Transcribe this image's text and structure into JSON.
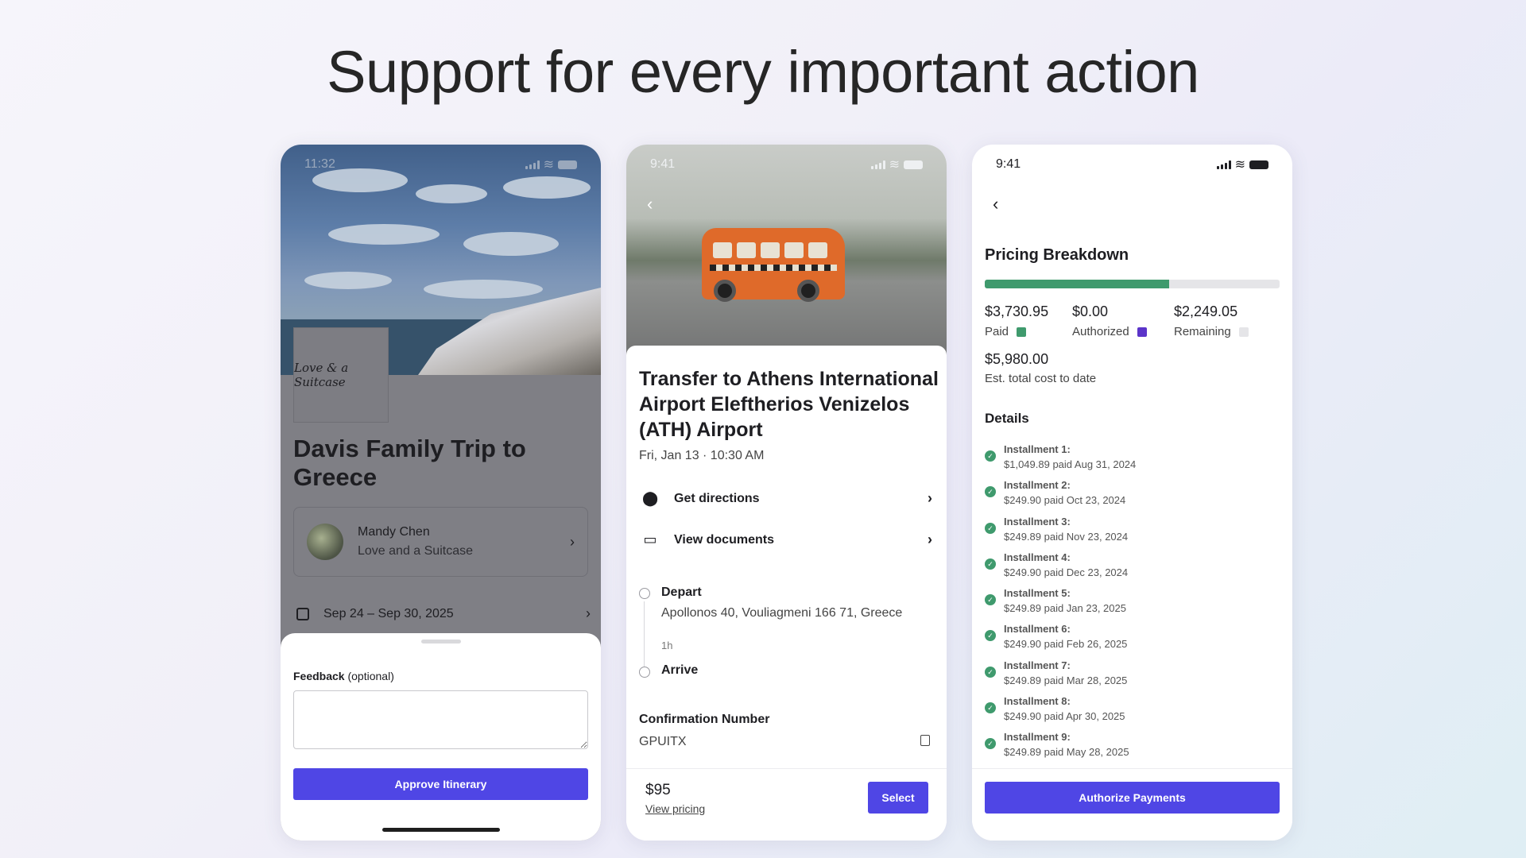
{
  "headline": "Support for every important action",
  "phone1": {
    "status_time": "11:32",
    "logo_text": "Love & a Suitcase",
    "trip_title": "Davis Family Trip to Greece",
    "agent_name": "Mandy Chen",
    "agent_org": "Love and a Suitcase",
    "date_range": "Sep 24 – Sep 30, 2025",
    "feedback_label": "Feedback",
    "feedback_optional": "(optional)",
    "feedback_value": "",
    "approve_label": "Approve Itinerary"
  },
  "phone2": {
    "status_time": "9:41",
    "title": "Transfer to Athens International Airport Eleftherios Venizelos (ATH) Airport",
    "date": "Fri, Jan 13 · 10:30 AM",
    "actions": [
      {
        "label": "Get directions",
        "icon": "location-pin-icon"
      },
      {
        "label": "View documents",
        "icon": "document-icon"
      }
    ],
    "depart_label": "Depart",
    "depart_address": "Apollonos 40, Vouliagmeni 166 71, Greece",
    "duration": "1h",
    "arrive_label": "Arrive",
    "confirmation_label": "Confirmation Number",
    "confirmation_value": "GPUITX",
    "price": "$95",
    "view_pricing": "View pricing",
    "select_label": "Select"
  },
  "phone3": {
    "status_time": "9:41",
    "title": "Pricing Breakdown",
    "progress_paid_fraction": 0.624,
    "paid_amount": "$3,730.95",
    "paid_label": "Paid",
    "authorized_amount": "$0.00",
    "authorized_label": "Authorized",
    "remaining_amount": "$2,249.05",
    "remaining_label": "Remaining",
    "total_amount": "$5,980.00",
    "total_label": "Est. total cost to date",
    "details_title": "Details",
    "installments": [
      {
        "name": "Installment 1:",
        "detail": "$1,049.89 paid Aug 31, 2024"
      },
      {
        "name": "Installment 2:",
        "detail": "$249.90 paid Oct 23, 2024"
      },
      {
        "name": "Installment 3:",
        "detail": "$249.89 paid Nov 23, 2024"
      },
      {
        "name": "Installment 4:",
        "detail": "$249.90 paid Dec 23, 2024"
      },
      {
        "name": "Installment 5:",
        "detail": "$249.89 paid Jan 23, 2025"
      },
      {
        "name": "Installment 6:",
        "detail": "$249.90 paid Feb 26, 2025"
      },
      {
        "name": "Installment 7:",
        "detail": "$249.89 paid Mar 28, 2025"
      },
      {
        "name": "Installment 8:",
        "detail": "$249.90 paid Apr 30, 2025"
      },
      {
        "name": "Installment 9:",
        "detail": "$249.89 paid May 28, 2025"
      }
    ],
    "authorize_label": "Authorize Payments"
  },
  "colors": {
    "accent": "#4f46e5",
    "paid": "#3f9a6d",
    "authorized": "#5b34c9",
    "remaining": "#e5e5e8"
  }
}
